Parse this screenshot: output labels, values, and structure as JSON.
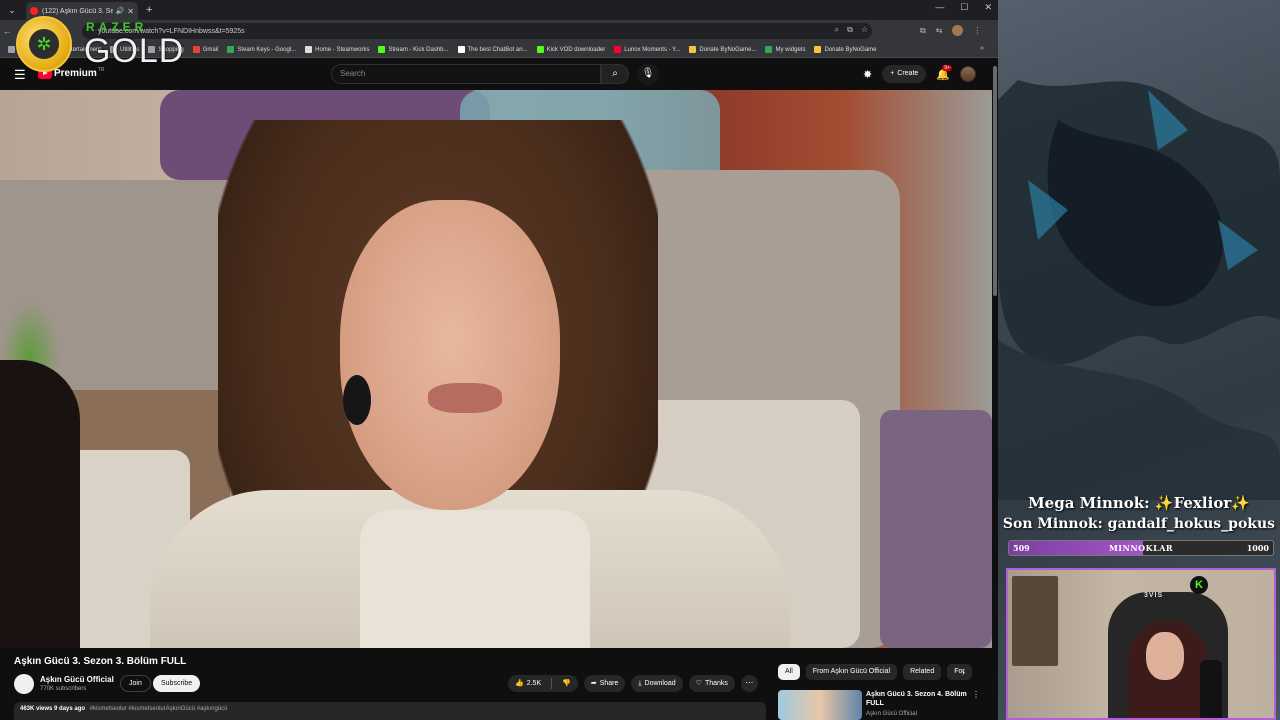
{
  "browser": {
    "tab_title": "(122) Aşkın Gücü 3. Sezon 3",
    "url": "youtube.com/watch?v=LFNDIHnbwss&t=5925s",
    "bookmarks": [
      {
        "label": "Education",
        "color": "#9aa0a6"
      },
      {
        "label": "Entertainment",
        "color": "#9aa0a6"
      },
      {
        "label": "Utilities",
        "color": "#9aa0a6"
      },
      {
        "label": "Shopping",
        "color": "#9aa0a6"
      },
      {
        "label": "Gmail",
        "color": "#ea4335"
      },
      {
        "label": "Steam Keys - Googl...",
        "color": "#34a853"
      },
      {
        "label": "Home - Steamworks",
        "color": "#dddddd"
      },
      {
        "label": "Stream - Kick Dashb...",
        "color": "#53fc18"
      },
      {
        "label": "The best ChatBot an...",
        "color": "#ffffff"
      },
      {
        "label": "Kick VOD downloader",
        "color": "#53fc18"
      },
      {
        "label": "Lunox Moments - Y...",
        "color": "#ff0033"
      },
      {
        "label": "Donate ByNoGame...",
        "color": "#f5c542"
      },
      {
        "label": "My widgets",
        "color": "#34a853"
      },
      {
        "label": "Donate ByNoGame",
        "color": "#f5c542"
      }
    ]
  },
  "overlay": {
    "razer": "RAZER",
    "gold": "GOLD"
  },
  "youtube": {
    "logo_text": "Premium",
    "region": "TR",
    "search_placeholder": "Search",
    "create_label": "Create",
    "notifications_badge": "9+",
    "video_title": "Aşkın Gücü 3. Sezon 3. Bölüm FULL",
    "channel_name": "Aşkın Gücü Official",
    "channel_subs": "770K subscribers",
    "join_label": "Join",
    "subscribe_label": "Subscribe",
    "like_count": "2.5K",
    "share_label": "Share",
    "download_label": "Download",
    "thanks_label": "Thanks",
    "views": "463K views",
    "age": "9 days ago",
    "tags": "#kismetseolur #kısmetseolurAşkınGücü #aşkıngücü",
    "chips": [
      "All",
      "From Aşkın Gücü Official",
      "Related",
      "For"
    ],
    "rec_title": "Aşkın Gücü 3. Sezon 4. Bölüm FULL",
    "rec_channel": "Aşkın Gücü Official"
  },
  "stream": {
    "mega_minnok": "Mega Minnok: ✨Fexlior✨",
    "son_minnok": "Son Minnok: gandalf_hokus_pokus",
    "goal_current": "509",
    "goal_label": "MINNOKLAR",
    "goal_target": "1000",
    "goal_progress": 0.509,
    "cam_brand": "3VIS",
    "kick_letter": "K"
  }
}
